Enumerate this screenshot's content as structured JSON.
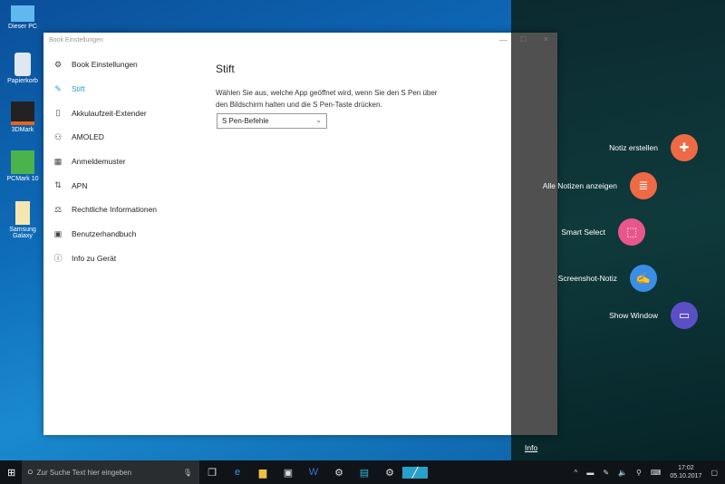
{
  "desktop": {
    "icons": [
      "Dieser PC",
      "Papierkorb",
      "3DMark",
      "PCMark 10",
      "Samsung Galaxy"
    ]
  },
  "window": {
    "title": "Book Einstellungen",
    "nav": [
      {
        "label": "Book Einstellungen",
        "icon": "gear-icon"
      },
      {
        "label": "Stift",
        "icon": "pen-icon",
        "selected": true
      },
      {
        "label": "Akkulaufzeit-Extender",
        "icon": "battery-icon"
      },
      {
        "label": "AMOLED",
        "icon": "amoled-icon"
      },
      {
        "label": "Anmeldemuster",
        "icon": "pattern-icon"
      },
      {
        "label": "APN",
        "icon": "arrows-icon"
      },
      {
        "label": "Rechtliche Informationen",
        "icon": "scales-icon"
      },
      {
        "label": "Benutzerhandbuch",
        "icon": "help-book-icon"
      },
      {
        "label": "Info zu Gerät",
        "icon": "info-icon"
      }
    ],
    "heading": "Stift",
    "description": "Wählen Sie aus, welche App geöffnet wird, wenn Sie den S Pen über den Bildschirm halten und die S Pen-Taste drücken.",
    "dropdown_value": "S Pen-Befehle"
  },
  "air_command": {
    "items": [
      {
        "label": "Notiz erstellen",
        "color": "#ee6a45"
      },
      {
        "label": "Alle Notizen anzeigen",
        "color": "#ee6a45"
      },
      {
        "label": "Smart Select",
        "color": "#e9578a"
      },
      {
        "label": "Screenshot-Notiz",
        "color": "#3a8ee6"
      },
      {
        "label": "Show Window",
        "color": "#5b4fc8"
      }
    ],
    "info_link": "Info"
  },
  "taskbar": {
    "search_placeholder": "Zur Suche Text hier eingeben",
    "time": "17:02",
    "date": "05.10.2017"
  }
}
